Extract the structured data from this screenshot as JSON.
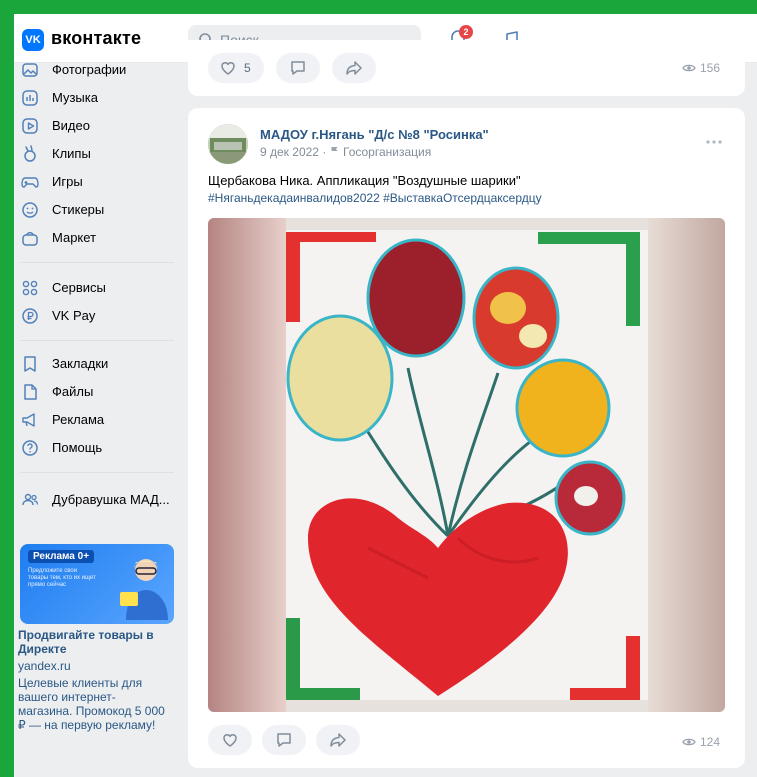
{
  "app": {
    "logo_text": "VK",
    "brand": "вконтакте",
    "search_placeholder": "Поиск",
    "notifications_count": "2"
  },
  "sidebar": {
    "items": [
      {
        "label": "Фотографии",
        "icon": "photos-icon"
      },
      {
        "label": "Музыка",
        "icon": "music-icon"
      },
      {
        "label": "Видео",
        "icon": "video-icon"
      },
      {
        "label": "Клипы",
        "icon": "clips-icon"
      },
      {
        "label": "Игры",
        "icon": "games-icon"
      },
      {
        "label": "Стикеры",
        "icon": "stickers-icon"
      },
      {
        "label": "Маркет",
        "icon": "market-icon"
      },
      {
        "label": "Сервисы",
        "icon": "services-icon"
      },
      {
        "label": "VK Pay",
        "icon": "vkpay-icon"
      },
      {
        "label": "Закладки",
        "icon": "bookmarks-icon"
      },
      {
        "label": "Файлы",
        "icon": "files-icon"
      },
      {
        "label": "Реклама",
        "icon": "ads-icon"
      },
      {
        "label": "Помощь",
        "icon": "help-icon"
      },
      {
        "label": "Дубравушка МАД...",
        "icon": "community-icon"
      }
    ],
    "ad": {
      "badge": "Реклама 0+",
      "small_text": "Предложите свои товары тем, кто их ищет прямо сейчас",
      "title": "Продвигайте товары в Директе",
      "domain": "yandex.ru",
      "text": "Целевые клиенты для вашего интернет-магазина. Промокод 5 000 ₽ — на первую рекламу!"
    }
  },
  "prev_post": {
    "likes": "5",
    "views": "156"
  },
  "post": {
    "author": "МАДОУ г.Нягань \"Д/с №8 \"Росинка\"",
    "date": "9 дек 2022",
    "separator": "·",
    "org_label": "Госорганизация",
    "text": "Щербакова Ника. Аппликация \"Воздушные шарики\"",
    "tags": "#Няганьдекадаинвалидов2022 #ВыставкаОтсердцаксердцу",
    "views": "124"
  },
  "colors": {
    "accent": "#0077ff",
    "link": "#2a5885",
    "frame": "#1aa63a",
    "badge": "#e64646"
  }
}
